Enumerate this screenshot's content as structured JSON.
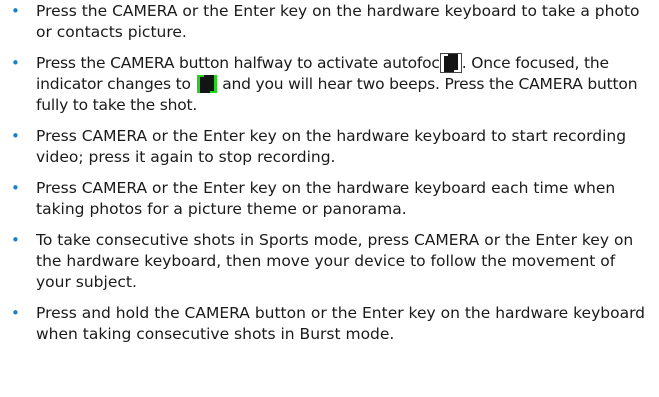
{
  "bullets": [
    {
      "text": "Press the CAMERA or the Enter key on the hardware keyboard to take a photo or contacts picture."
    },
    {
      "text_a": "Press the CAMERA button halfway to activate autofoc",
      "text_b": ". Once focused, the indicator changes to",
      "text_c": " and you will hear two beeps. Press the CAMERA button fully to take the shot."
    },
    {
      "text": "Press CAMERA or the Enter key on the hardware keyboard to start recording video; press it again to stop recording."
    },
    {
      "text": "Press CAMERA or the Enter key on the hardware keyboard each time when taking photos for a picture theme or panorama."
    },
    {
      "text": "To take consecutive shots in Sports mode, press CAMERA or the Enter key on the hardware keyboard, then move your device to follow the movement of your subject."
    },
    {
      "text": "Press and hold the CAMERA button or the Enter key on the hardware keyboard when taking consecutive shots in Burst mode."
    }
  ],
  "bullet_glyph": "•",
  "colors": {
    "bullet": "#1f7fc4",
    "text": "#1a1a1a",
    "focus_indicator_idle": "#ffffff",
    "focus_indicator_locked": "#22d41c"
  },
  "icons": {
    "autofocus_idle": "autofocus-indicator-white-icon",
    "autofocus_locked": "autofocus-indicator-green-icon"
  }
}
